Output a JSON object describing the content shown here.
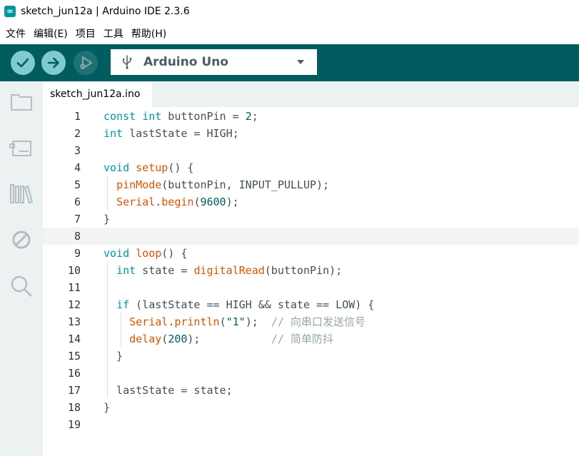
{
  "window": {
    "title": "sketch_jun12a | Arduino IDE 2.3.6",
    "app_icon_glyph": "∞"
  },
  "menu": [
    "文件",
    "编辑(E)",
    "项目",
    "工具",
    "帮助(H)"
  ],
  "toolbar": {
    "board_name": "Arduino Uno",
    "colors": {
      "bar": "#005c5f",
      "button": "#7fcbcd"
    }
  },
  "sidebar": {
    "icons": [
      "folder-icon",
      "board-manager-icon",
      "library-icon",
      "debug-icon",
      "search-icon"
    ]
  },
  "tabs": [
    {
      "label": "sketch_jun12a.ino",
      "active": true
    }
  ],
  "editor": {
    "current_line": 8,
    "line_numbers": [
      "1",
      "2",
      "3",
      "4",
      "5",
      "6",
      "7",
      "8",
      "9",
      "10",
      "11",
      "12",
      "13",
      "14",
      "15",
      "16",
      "17",
      "18",
      "19"
    ],
    "lines": [
      [
        [
          "kw",
          "const"
        ],
        [
          "p",
          " "
        ],
        [
          "kw",
          "int"
        ],
        [
          "p",
          " buttonPin = "
        ],
        [
          "num",
          "2"
        ],
        [
          "p",
          ";"
        ]
      ],
      [
        [
          "kw",
          "int"
        ],
        [
          "p",
          " lastState = HIGH;"
        ]
      ],
      [],
      [
        [
          "kw",
          "void"
        ],
        [
          "p",
          " "
        ],
        [
          "fn",
          "setup"
        ],
        [
          "p",
          "() {"
        ]
      ],
      [
        [
          "p",
          "  "
        ],
        [
          "fn",
          "pinMode"
        ],
        [
          "p",
          "(buttonPin, INPUT_PULLUP);"
        ]
      ],
      [
        [
          "p",
          "  "
        ],
        [
          "fn",
          "Serial"
        ],
        [
          "p",
          "."
        ],
        [
          "fn",
          "begin"
        ],
        [
          "p",
          "("
        ],
        [
          "num",
          "9600"
        ],
        [
          "p",
          ");"
        ]
      ],
      [
        [
          "p",
          "}"
        ]
      ],
      [],
      [
        [
          "kw",
          "void"
        ],
        [
          "p",
          " "
        ],
        [
          "fn",
          "loop"
        ],
        [
          "p",
          "() {"
        ]
      ],
      [
        [
          "p",
          "  "
        ],
        [
          "kw",
          "int"
        ],
        [
          "p",
          " state = "
        ],
        [
          "fn",
          "digitalRead"
        ],
        [
          "p",
          "(buttonPin);"
        ]
      ],
      [],
      [
        [
          "p",
          "  "
        ],
        [
          "kw",
          "if"
        ],
        [
          "p",
          " (lastState == HIGH && state == LOW) {"
        ]
      ],
      [
        [
          "p",
          "    "
        ],
        [
          "fn",
          "Serial"
        ],
        [
          "p",
          "."
        ],
        [
          "fn",
          "println"
        ],
        [
          "p",
          "("
        ],
        [
          "str",
          "\"1\""
        ],
        [
          "p",
          ");  "
        ],
        [
          "cmt",
          "// 向串口发送信号"
        ]
      ],
      [
        [
          "p",
          "    "
        ],
        [
          "fn",
          "delay"
        ],
        [
          "p",
          "("
        ],
        [
          "num",
          "200"
        ],
        [
          "p",
          ");           "
        ],
        [
          "cmt",
          "// 简单防抖"
        ]
      ],
      [
        [
          "p",
          "  }"
        ]
      ],
      [],
      [
        [
          "p",
          "  lastState = state;"
        ]
      ],
      [
        [
          "p",
          "}"
        ]
      ],
      []
    ]
  }
}
